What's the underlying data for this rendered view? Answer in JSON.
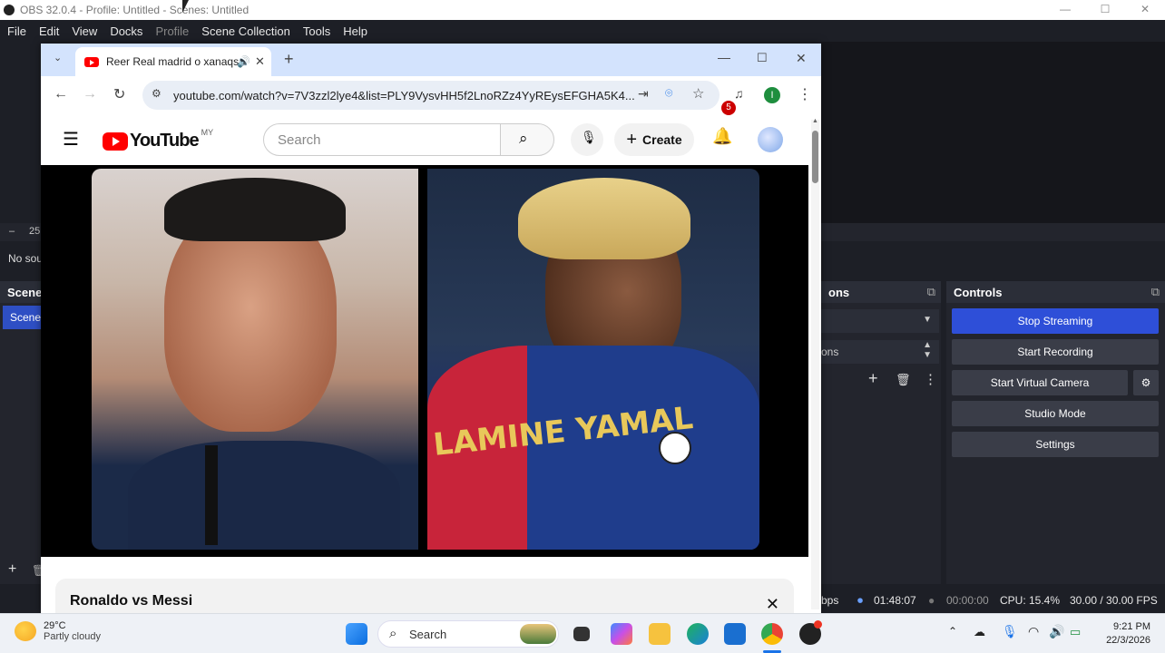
{
  "obs": {
    "title": "OBS 32.0.4 - Profile: Untitled - Scenes: Untitled",
    "menu": [
      "File",
      "Edit",
      "View",
      "Docks",
      "Profile",
      "Scene Collection",
      "Tools",
      "Help"
    ],
    "no_source_text": "No sou",
    "zoom_text": "25",
    "scenes_header": "Scene",
    "scene_item": "Scene",
    "transitions_header": "ons",
    "transitions_row": "ons",
    "controls_header": "Controls",
    "controls": {
      "stop_streaming": "Stop Streaming",
      "start_recording": "Start Recording",
      "start_virtual_camera": "Start Virtual Camera",
      "studio_mode": "Studio Mode",
      "settings": "Settings"
    },
    "status": {
      "kbps": "bps",
      "stream_time": "01:48:07",
      "rec_time": "00:00:00",
      "cpu": "CPU: 15.4%",
      "fps": "30.00 / 30.00 FPS"
    },
    "accent_color": "#2e4fd8"
  },
  "browser": {
    "tab_title": "Reer Real madrid o xanaqsa",
    "url": "youtube.com/watch?v=7V3zzl2lye4&list=PLY9VysvHH5f2LnoRZz4YyREysEFGHA5K4...",
    "profile_initial": "I"
  },
  "youtube": {
    "logo_text": "YouTube",
    "country": "MY",
    "search_placeholder": "Search",
    "create_label": "Create",
    "notification_count": "5",
    "video_title": "Ronaldo vs Messi",
    "jersey_text": "LAMINE YAMAL"
  },
  "taskbar": {
    "temp": "29°C",
    "weather": "Partly cloudy",
    "search_label": "Search",
    "time": "9:21 PM",
    "date": "22/3/2026"
  }
}
